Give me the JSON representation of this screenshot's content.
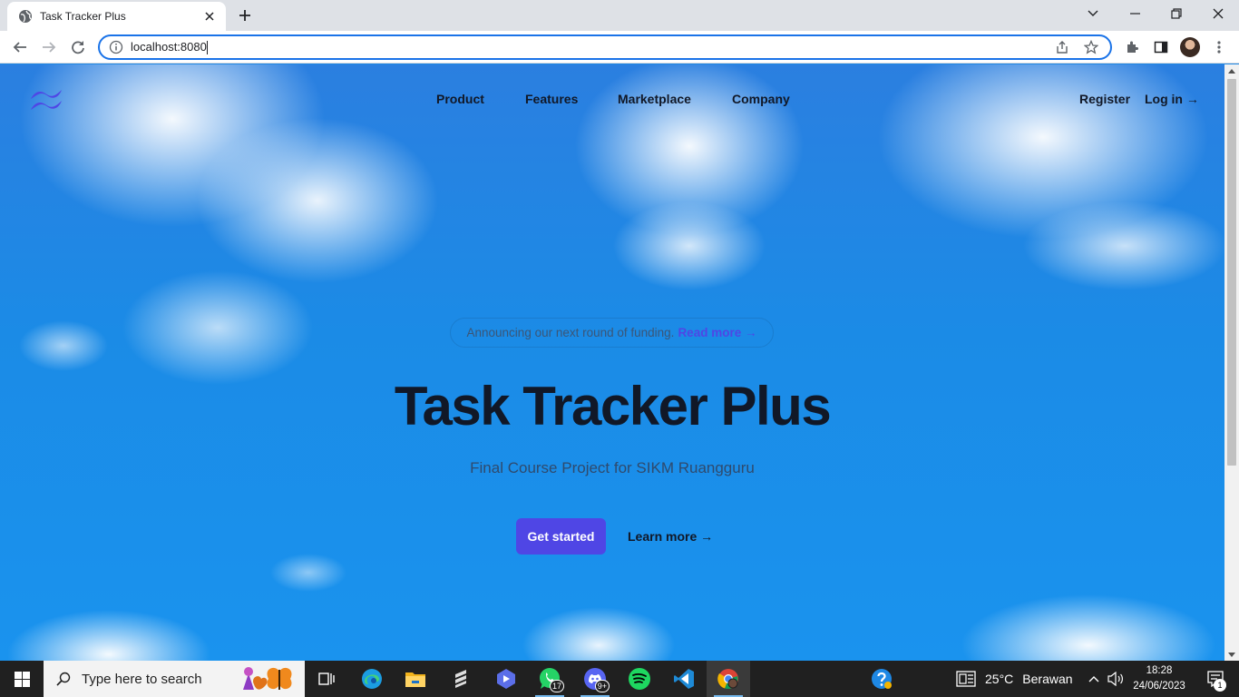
{
  "browser": {
    "tab": {
      "title": "Task Tracker Plus",
      "favicon": "globe-icon"
    },
    "address_bar": {
      "url": "localhost:8080"
    },
    "icons": [
      "back-icon",
      "forward-icon",
      "reload-icon",
      "info-icon",
      "share-icon",
      "star-icon",
      "extensions-icon",
      "side-panel-icon",
      "profile-avatar",
      "menu-icon"
    ]
  },
  "site": {
    "logo": "tailwind-logo-icon",
    "nav": {
      "product": "Product",
      "features": "Features",
      "marketplace": "Marketplace",
      "company": "Company",
      "register": "Register",
      "login": "Log in →"
    },
    "announcement": {
      "text": "Announcing our next round of funding.",
      "link": "Read more →"
    },
    "hero": {
      "title": "Task Tracker Plus",
      "subtitle": "Final Course Project for SIKM Ruangguru",
      "primary_cta": "Get started",
      "secondary_cta": "Learn more →"
    },
    "colors": {
      "accent": "#4f46e5",
      "text": "#111827",
      "sky": "#1e88e5"
    }
  },
  "taskbar": {
    "search_placeholder": "Type here to search",
    "apps": [
      {
        "name": "task-view"
      },
      {
        "name": "edge"
      },
      {
        "name": "file-explorer"
      },
      {
        "name": "sublime-text"
      },
      {
        "name": "app-blue"
      },
      {
        "name": "whatsapp",
        "badge": "17"
      },
      {
        "name": "discord",
        "badge": "9+"
      },
      {
        "name": "spotify"
      },
      {
        "name": "vscode"
      },
      {
        "name": "chrome"
      },
      {
        "name": "help"
      }
    ],
    "weather": {
      "temp": "25°C",
      "condition": "Berawan"
    },
    "clock": {
      "time": "18:28",
      "date": "24/06/2023"
    },
    "notifications": "1"
  }
}
